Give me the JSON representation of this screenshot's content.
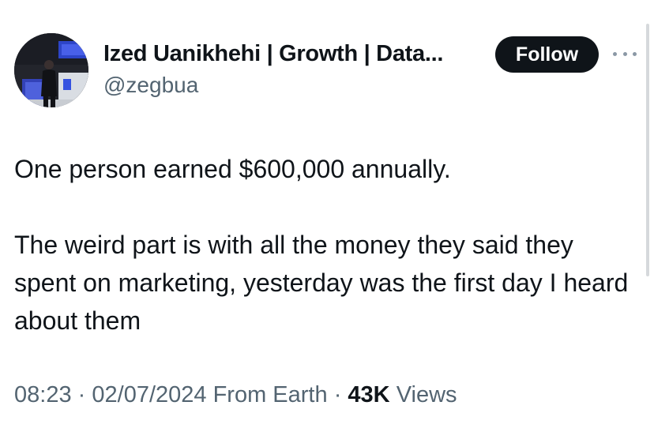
{
  "author": {
    "display_name": "Ized Uanikhehi | Growth | Data...",
    "handle": "@zegbua",
    "avatar_icon": "profile-photo"
  },
  "actions": {
    "follow_label": "Follow",
    "more_icon": "more-options-icon"
  },
  "tweet": {
    "paragraphs": [
      "One person earned $600,000 annually.",
      "The weird part is with all the money they said they spent on marketing, yesterday was the first day I heard about them"
    ]
  },
  "meta": {
    "time": "08:23",
    "separator": "·",
    "date": "02/07/2024",
    "source": "From Earth",
    "views_count": "43K",
    "views_label": "Views"
  },
  "colors": {
    "text": "#0f1419",
    "secondary": "#536471",
    "button_bg": "#0f1419"
  }
}
